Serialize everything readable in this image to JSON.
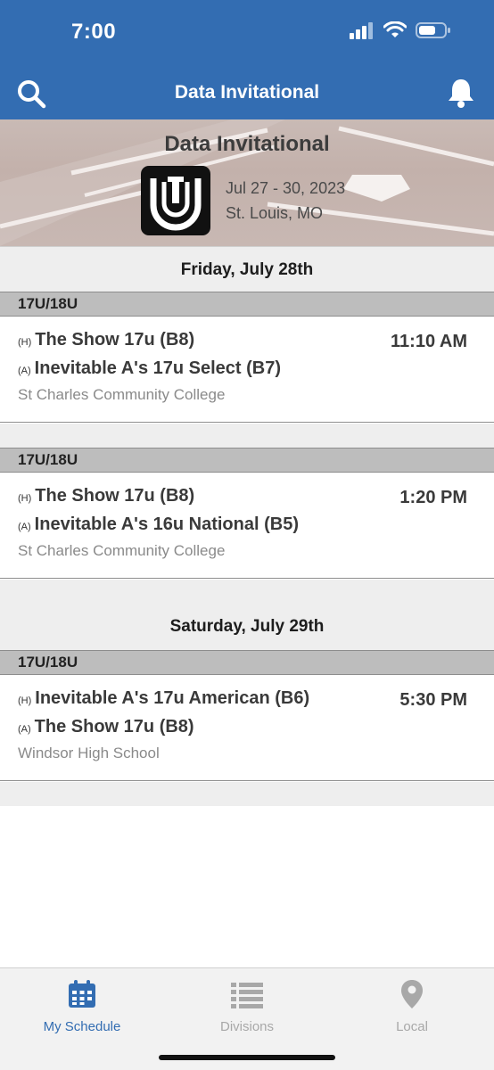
{
  "status": {
    "time": "7:00"
  },
  "nav": {
    "title": "Data Invitational"
  },
  "event": {
    "title": "Data Invitational",
    "dates": "Jul 27 - 30, 2023",
    "location": "St. Louis, MO"
  },
  "schedule": {
    "days": [
      {
        "label": "Friday, July 28th"
      },
      {
        "label": "Saturday, July 29th"
      }
    ],
    "games": [
      {
        "division": "17U/18U",
        "home_tag": "(H)",
        "home": "The Show 17u (B8)",
        "away_tag": "(A)",
        "away": "Inevitable A's 17u Select (B7)",
        "time": "11:10 AM",
        "venue": "St Charles Community College"
      },
      {
        "division": "17U/18U",
        "home_tag": "(H)",
        "home": "The Show 17u (B8)",
        "away_tag": "(A)",
        "away": "Inevitable A's 16u National (B5)",
        "time": "1:20 PM",
        "venue": "St Charles Community College"
      },
      {
        "division": "17U/18U",
        "home_tag": "(H)",
        "home": "Inevitable A's 17u American (B6)",
        "away_tag": "(A)",
        "away": "The Show 17u (B8)",
        "time": "5:30 PM",
        "venue": "Windsor High School"
      }
    ]
  },
  "tabs": [
    {
      "label": "My Schedule",
      "icon": "calendar-icon",
      "active": true
    },
    {
      "label": "Divisions",
      "icon": "list-icon",
      "active": false
    },
    {
      "label": "Local",
      "icon": "location-pin-icon",
      "active": false
    }
  ],
  "colors": {
    "brand": "#336db2",
    "tab_active": "#336db2",
    "tab_inactive": "#a8a8a8",
    "division_bar": "#bdbdbd"
  }
}
